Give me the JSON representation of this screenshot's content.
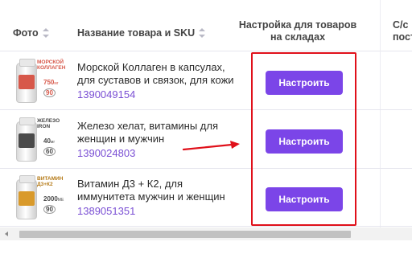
{
  "table": {
    "headers": {
      "photo": "Фото",
      "name": "Название товара и SKU",
      "settings_line1": "Настройка для товаров",
      "settings_line2": "на складах",
      "cost_line1": "С/с",
      "cost_line2": "пост"
    },
    "rows": [
      {
        "name_line1": "Морской Коллаген в капсулах,",
        "name_line2": "для суставов и связок, для кожи",
        "sku": "1390049154",
        "button": "Настроить",
        "image": {
          "brand_line1": "Морской",
          "brand_line2": "коллаген",
          "dose": "750",
          "dose_unit": "мг",
          "count": "90",
          "count_unit": "капс",
          "accent": "#d7584a"
        }
      },
      {
        "name_line1": "Железо хелат, витамины для",
        "name_line2": "женщин и мужчин",
        "sku": "1390024803",
        "button": "Настроить",
        "image": {
          "brand_line1": "Железо",
          "brand_line2": "iron",
          "dose": "40",
          "dose_unit": "мг",
          "count": "60",
          "count_unit": "капс",
          "accent": "#4a4a4a"
        }
      },
      {
        "name_line1": "Витамин Д3 + К2, для",
        "name_line2": "иммунитета мужчин и женщин",
        "sku": "1389051351",
        "button": "Настроить",
        "image": {
          "brand_line1": "Витамин",
          "brand_line2": "Д3+К2",
          "dose": "2000",
          "dose_unit": "ME",
          "count": "90",
          "count_unit": "капс",
          "accent": "#d99a2b"
        }
      }
    ]
  },
  "colors": {
    "button": "#7b45e8",
    "sku_link": "#7a4fd4",
    "highlight_border": "#e0101a",
    "arrow": "#e0101a"
  }
}
